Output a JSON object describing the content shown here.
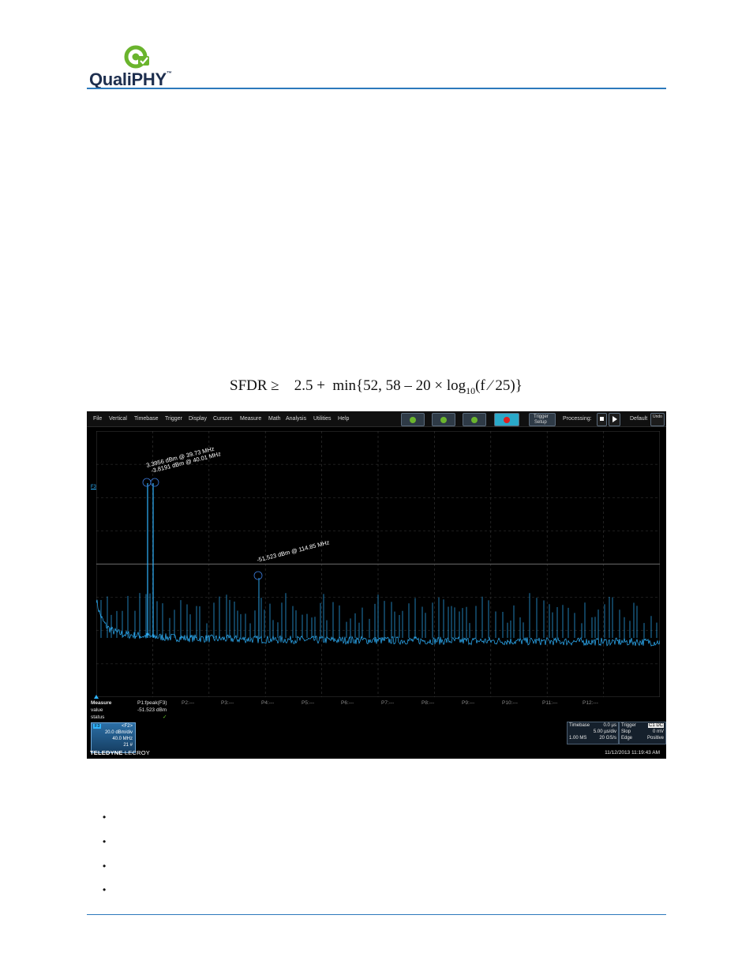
{
  "header": {
    "logo_text": "QualiPHY",
    "logo_tm": "™"
  },
  "formula": {
    "lhs": "SFDR ≥",
    "rhs_a": "2.5 +  min{52, 58 – 20 × log",
    "rhs_sub": "10",
    "rhs_b": "(f ⁄ 25)}"
  },
  "scope": {
    "menu": [
      "File",
      "Vertical",
      "Timebase",
      "Trigger",
      "Display",
      "Cursors",
      "Measure",
      "Math",
      "Analysis",
      "Utilities",
      "Help"
    ],
    "trigger_setup": [
      "Trigger",
      "Setup"
    ],
    "processing_label": "Processing:",
    "default_label": "Default",
    "undo_label": "Undo",
    "trace_label": "F3",
    "peak_labels": {
      "p1": "3.3956 dBm @ 39.73 MHz",
      "p2": "-3.8191 dBm @ 40.01 MHz",
      "spur": "-51.523 dBm @ 114.85 MHz"
    },
    "colors": {
      "trace": "#2fb4ff",
      "background": "#000000",
      "grid": "#3a3a3a",
      "accent": "#2c79bc"
    },
    "measure": {
      "title": "Measure",
      "rows": [
        "value",
        "status"
      ],
      "p1_name": "P1:fpeak(F3)",
      "p1_value": "-51.523 dBm",
      "p1_status": "✓",
      "params": [
        "P2:---",
        "P3:---",
        "P4:---",
        "P5:---",
        "P6:---",
        "P7:---",
        "P8:---",
        "P9:---",
        "P10:---",
        "P11:---",
        "P12:---"
      ]
    },
    "f3_box": {
      "tag": "F3",
      "name": "<F2>",
      "scale": "20.0 dBm/div",
      "center": "40.0 MHz",
      "count": "21 #"
    },
    "timebase": {
      "label": "Timebase",
      "delay": "0.0 µs",
      "per_div": "5.00 µs/div",
      "samples": "1.00 MS",
      "rate": "20 GS/s"
    },
    "trigger": {
      "label": "Trigger",
      "mode": "C1 DC",
      "slope_label": "Slop",
      "slope_value": "0 mV",
      "edge_label": "Edge",
      "edge_value": "Positive"
    },
    "brand_bold": "TELEDYNE",
    "brand_lite": " LECROY",
    "datetime": "11/12/2013 11:19:43 AM"
  }
}
